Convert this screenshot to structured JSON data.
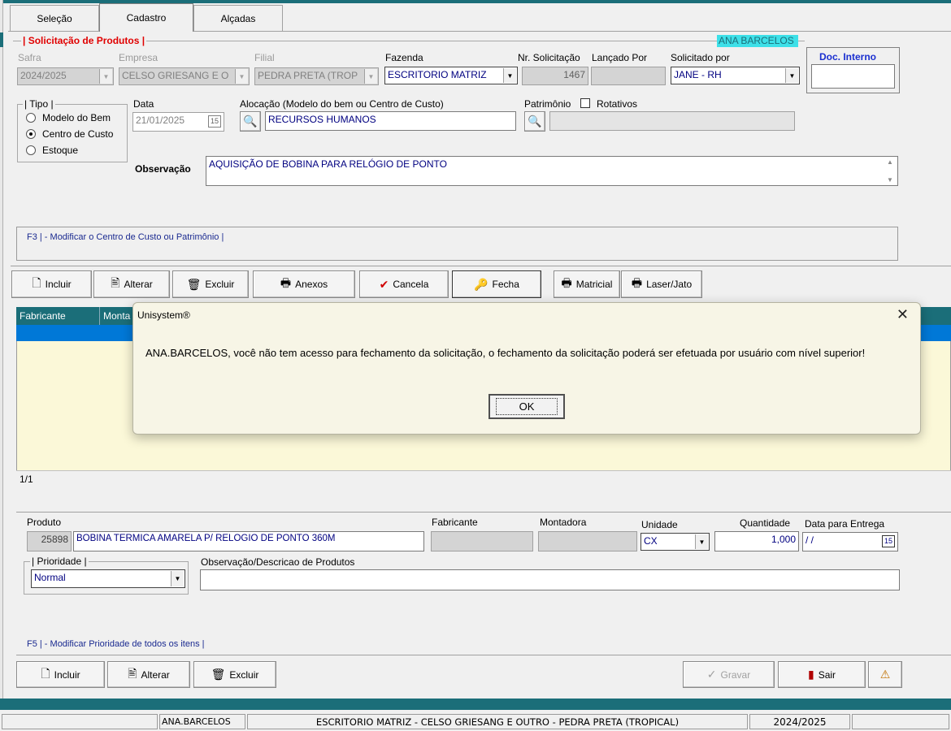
{
  "tabs": [
    "Seleção",
    "Cadastro",
    "Alçadas"
  ],
  "user_badge": "ANA BARCELOS",
  "header_group": {
    "title": "| Solicitação de Produtos |"
  },
  "labels": {
    "safra": "Safra",
    "empresa": "Empresa",
    "filial": "Filial",
    "fazenda": "Fazenda",
    "nr_solicitacao": "Nr. Solicitação",
    "lancado_por": "Lançado Por",
    "solicitado_por": "Solicitado por",
    "doc_interno": "Doc. Interno",
    "data": "Data",
    "alocacao": "Alocação (Modelo do bem ou Centro de Custo)",
    "patrimonio": "Patrimônio",
    "rotativos": "Rotativos",
    "observacao": "Observação"
  },
  "values": {
    "safra": "2024/2025",
    "empresa": "CELSO GRIESANG E O",
    "filial": "PEDRA PRETA (TROP",
    "fazenda": "ESCRITORIO MATRIZ",
    "nr_solicitacao": "1467",
    "lancado_por": "",
    "solicitado_por": "JANE - RH",
    "doc_interno": "",
    "data": "21/01/2025",
    "data_icon": "15",
    "alocacao": "RECURSOS HUMANOS",
    "patrimonio": "",
    "observacao": "AQUISIÇÃO DE BOBINA PARA RELÓGIO DE PONTO"
  },
  "tipo": {
    "title": "| Tipo |",
    "options": [
      "Modelo do Bem",
      "Centro de Custo",
      "Estoque"
    ],
    "selected": "Centro de Custo"
  },
  "hint_f3": "F3 | - Modificar o Centro de Custo ou Patrimônio |",
  "toolbar": {
    "incluir": "Incluir",
    "alterar": "Alterar",
    "excluir": "Excluir",
    "anexos": "Anexos",
    "cancela": "Cancela",
    "fecha": "Fecha",
    "matricial": "Matricial",
    "laser": "Laser/Jato"
  },
  "grid": {
    "columns": [
      "Fabricante",
      "Monta"
    ],
    "pager": "1/1"
  },
  "item": {
    "labels": {
      "produto": "Produto",
      "fabricante": "Fabricante",
      "montadora": "Montadora",
      "unidade": "Unidade",
      "quantidade": "Quantidade",
      "data_entrega": "Data para Entrega",
      "prioridade": "| Prioridade |",
      "obs_produtos": "Observação/Descricao de Produtos"
    },
    "values": {
      "produto_code": "25898",
      "produto_desc": "BOBINA TERMICA AMARELA P/ RELOGIO DE PONTO 360M",
      "fabricante": "",
      "montadora": "",
      "unidade": "CX",
      "quantidade": "1,000",
      "data_entrega": "/ /",
      "prioridade": "Normal",
      "obs_produtos": ""
    }
  },
  "hint_f5": "F5 | - Modificar Prioridade de todos os itens |",
  "bottom_toolbar": {
    "incluir": "Incluir",
    "alterar": "Alterar",
    "excluir": "Excluir",
    "gravar": "Gravar",
    "sair": "Sair"
  },
  "statusbar": {
    "user": "ANA.BARCELOS",
    "location": "ESCRITORIO MATRIZ - CELSO GRIESANG E OUTRO - PEDRA PRETA (TROPICAL)",
    "safra": "2024/2025"
  },
  "dialog": {
    "title": "Unisystem®",
    "message": "ANA.BARCELOS, você não tem acesso para fechamento da solicitação, o fechamento da solicitação poderá ser efetuada por usuário com nível superior!",
    "ok": "OK"
  },
  "colors": {
    "teal": "#1b6e79",
    "badge": "#3de0e8",
    "highlight_blue": "#0078d7",
    "grid_bg": "#fbf8d8",
    "red_title": "#e00000"
  }
}
